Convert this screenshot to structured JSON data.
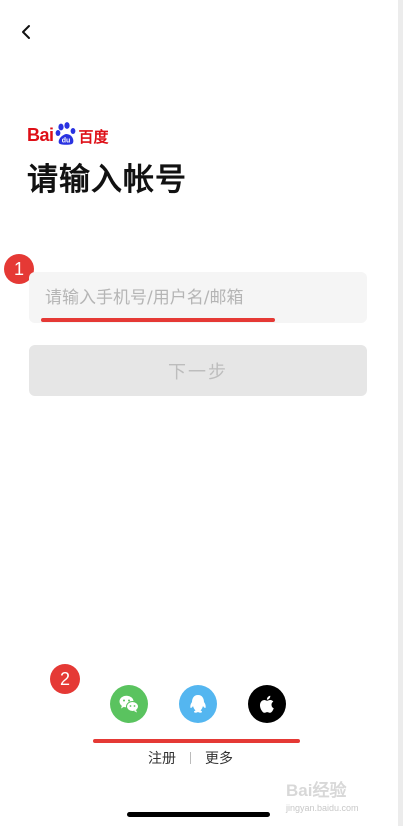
{
  "header": {
    "back_icon": "chevron-left-icon"
  },
  "logo": {
    "latin": "Bai",
    "icon": "paw-icon",
    "paw_text": "du",
    "chinese": "百度"
  },
  "title": "请输入帐号",
  "annotations": {
    "badge1": "1",
    "badge2": "2",
    "accent": "#e53935"
  },
  "account_input": {
    "placeholder": "请输入手机号/用户名/邮箱",
    "value": ""
  },
  "next_button": {
    "label": "下一步"
  },
  "social_login": [
    {
      "name": "wechat",
      "icon": "wechat-icon",
      "color": "#5ac35f"
    },
    {
      "name": "qq",
      "icon": "qq-icon",
      "color": "#54b6f0"
    },
    {
      "name": "apple",
      "icon": "apple-icon",
      "color": "#000000"
    }
  ],
  "bottom_links": {
    "register": "注册",
    "more": "更多"
  },
  "watermark": {
    "brand": "Bai经验",
    "url": "jingyan.baidu.com"
  }
}
